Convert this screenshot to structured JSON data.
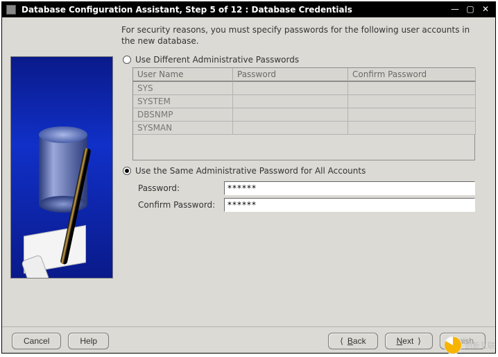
{
  "titlebar": {
    "title": "Database Configuration Assistant, Step 5 of 12 : Database Credentials"
  },
  "main": {
    "intro": "For security reasons, you must specify passwords for the following user accounts in the new database.",
    "option_different": "Use Different Administrative Passwords",
    "option_same": "Use the Same Administrative Password for All Accounts",
    "table": {
      "headers": {
        "user": "User Name",
        "password": "Password",
        "confirm": "Confirm Password"
      },
      "rows": [
        {
          "user": "SYS",
          "password": "",
          "confirm": ""
        },
        {
          "user": "SYSTEM",
          "password": "",
          "confirm": ""
        },
        {
          "user": "DBSNMP",
          "password": "",
          "confirm": ""
        },
        {
          "user": "SYSMAN",
          "password": "",
          "confirm": ""
        }
      ]
    },
    "form": {
      "password_label": "Password:",
      "confirm_label": "Confirm Password:",
      "password_value": "******",
      "confirm_value": "******"
    }
  },
  "footer": {
    "cancel": "Cancel",
    "help": "Help",
    "back_prefix": "B",
    "back_rest": "ack",
    "next_prefix": "N",
    "next_rest": "ext",
    "finish_prefix": "F",
    "finish_rest": "inish"
  },
  "watermark": "创新互联"
}
